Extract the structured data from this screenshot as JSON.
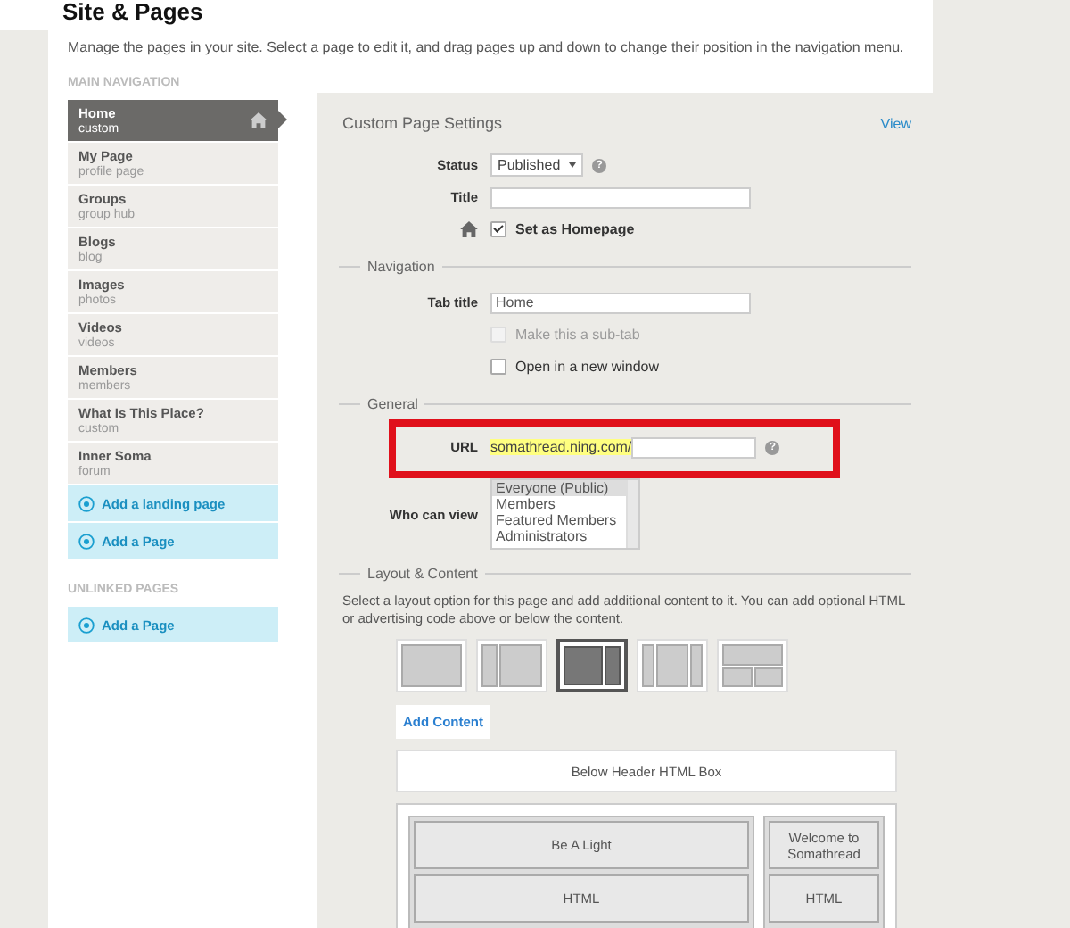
{
  "page": {
    "title": "Site & Pages",
    "description": "Manage the pages in your site. Select a page to edit it, and drag pages up and down to change their position in the navigation menu."
  },
  "main_navigation": {
    "heading": "MAIN NAVIGATION",
    "pages": [
      {
        "name": "Home",
        "type": "custom",
        "selected": true,
        "home": true
      },
      {
        "name": "My Page",
        "type": "profile page",
        "selected": false,
        "home": false
      },
      {
        "name": "Groups",
        "type": "group hub",
        "selected": false,
        "home": false
      },
      {
        "name": "Blogs",
        "type": "blog",
        "selected": false,
        "home": false
      },
      {
        "name": "Images",
        "type": "photos",
        "selected": false,
        "home": false
      },
      {
        "name": "Videos",
        "type": "videos",
        "selected": false,
        "home": false
      },
      {
        "name": "Members",
        "type": "members",
        "selected": false,
        "home": false
      },
      {
        "name": "What Is This Place?",
        "type": "custom",
        "selected": false,
        "home": false
      },
      {
        "name": "Inner Soma",
        "type": "forum",
        "selected": false,
        "home": false
      }
    ],
    "actions": [
      "Add a landing page",
      "Add a Page"
    ]
  },
  "unlinked_pages": {
    "heading": "UNLINKED PAGES",
    "actions": [
      "Add a Page"
    ]
  },
  "settings": {
    "title": "Custom Page Settings",
    "view_link": "View",
    "status": {
      "label": "Status",
      "value": "Published",
      "help": "?"
    },
    "title_field": {
      "label": "Title"
    },
    "homepage": {
      "label": "Set as Homepage",
      "checked": true
    },
    "navigation": {
      "legend": "Navigation",
      "tab_title": {
        "label": "Tab title",
        "value": "Home"
      },
      "sub_tab": {
        "label": "Make this a sub-tab",
        "checked": false,
        "disabled": true
      },
      "new_window": {
        "label": "Open in a new window",
        "checked": false,
        "disabled": false
      }
    },
    "general": {
      "legend": "General",
      "url": {
        "label": "URL",
        "prefix": "somathread.ning.com/",
        "help": "?"
      },
      "who_can_view": {
        "label": "Who can view",
        "options": [
          {
            "label": "Everyone (Public)",
            "selected": true
          },
          {
            "label": "Members",
            "selected": false
          },
          {
            "label": "Featured Members",
            "selected": false
          },
          {
            "label": "Administrators",
            "selected": false
          }
        ]
      }
    },
    "layout": {
      "legend": "Layout & Content",
      "description": "Select a layout option for this page and add additional content to it. You can add optional HTML or advertising code above or below the content.",
      "options": [
        {
          "kind": "single",
          "selected": false
        },
        {
          "kind": "left-narrow",
          "selected": false
        },
        {
          "kind": "right-narrow",
          "selected": true
        },
        {
          "kind": "three",
          "selected": false
        },
        {
          "kind": "header-split",
          "selected": false
        }
      ],
      "add_content": "Add Content",
      "below_header": "Below Header HTML Box",
      "main_column": [
        "Be A Light",
        "HTML"
      ],
      "side_column": [
        "Welcome to Somathread",
        "HTML"
      ]
    }
  }
}
